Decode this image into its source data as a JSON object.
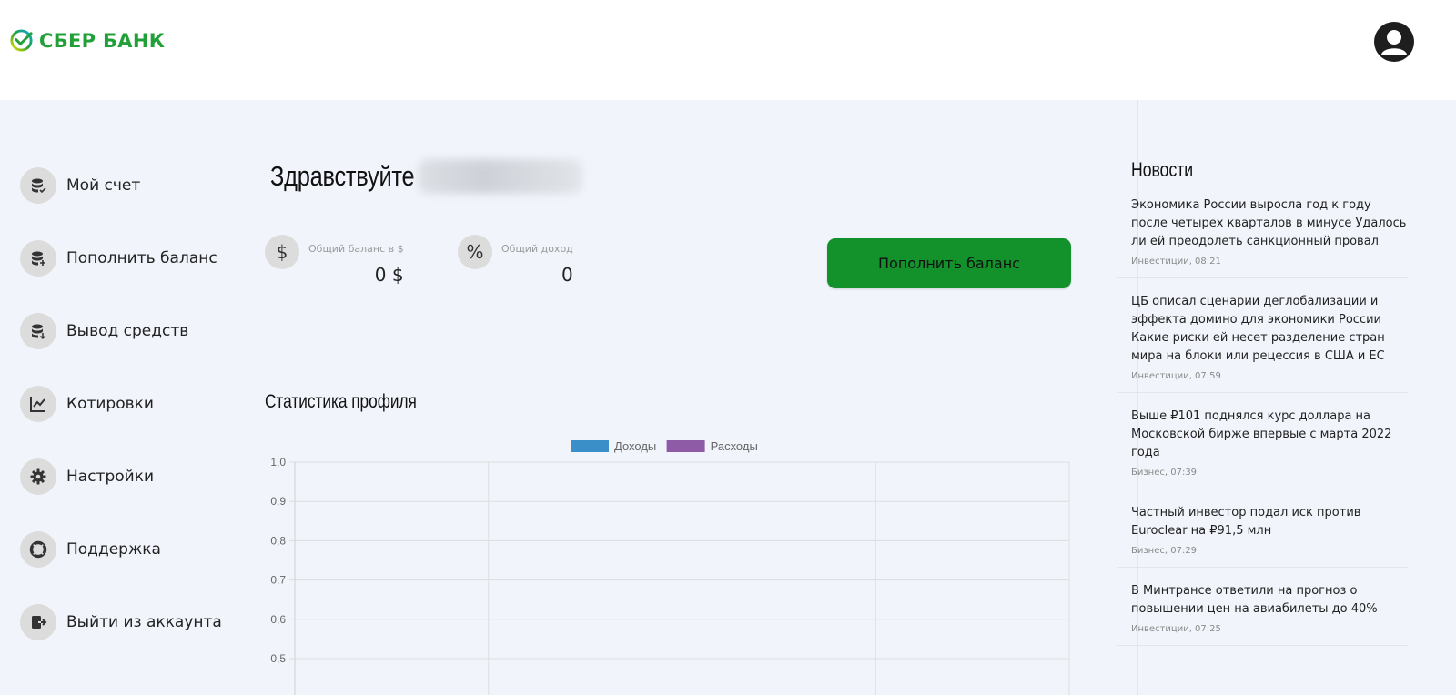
{
  "header": {
    "logo_text": "СБЕР БАНК",
    "logo_icon": "sber-check-icon",
    "avatar_icon": "user-avatar-icon",
    "brand_color": "#21a038"
  },
  "sidebar": {
    "items": [
      {
        "label": "Мой счет",
        "icon": "coins-check-icon"
      },
      {
        "label": "Пополнить баланс",
        "icon": "coins-plus-icon"
      },
      {
        "label": "Вывод средств",
        "icon": "coins-down-icon"
      },
      {
        "label": "Котировки",
        "icon": "chart-line-icon"
      },
      {
        "label": "Настройки",
        "icon": "gear-icon"
      },
      {
        "label": "Поддержка",
        "icon": "lifebuoy-icon"
      },
      {
        "label": "Выйти из аккаунта",
        "icon": "logout-icon"
      }
    ]
  },
  "greeting": {
    "text": "Здравствуйте"
  },
  "stats": {
    "balance": {
      "icon": "$",
      "label": "Общий баланс в $",
      "value": "0 $"
    },
    "income": {
      "icon": "%",
      "label": "Общий доход",
      "value": "0"
    }
  },
  "topup_button": {
    "label": "Пополнить баланс",
    "color": "#13922b"
  },
  "profile_stats": {
    "title": "Статистика профиля"
  },
  "chart_data": {
    "type": "bar",
    "series": [
      {
        "name": "Доходы",
        "color": "#3b8fc9",
        "values": []
      },
      {
        "name": "Расходы",
        "color": "#8e5ba6",
        "values": []
      }
    ],
    "y_ticks": [
      "1,0",
      "0,9",
      "0,8",
      "0,7",
      "0,6",
      "0,5"
    ],
    "ylim": [
      0,
      1
    ],
    "grid": true,
    "legend": "top-center"
  },
  "news": {
    "title": "Новости",
    "items": [
      {
        "headline": "Экономика России выросла год к году после четырех кварталов в минусе Удалось ли ей преодолеть санкционный провал",
        "meta": "Инвестиции, 08:21"
      },
      {
        "headline": "ЦБ описал сценарии деглобализации и эффекта домино для экономики России Какие риски ей несет разделение стран мира на блоки или рецессия в США и ЕС",
        "meta": "Инвестиции, 07:59"
      },
      {
        "headline": "Выше ₽101 поднялся курс доллара на Московской бирже впервые с марта 2022 года",
        "meta": "Бизнес, 07:39"
      },
      {
        "headline": "Частный инвестор подал иск против Euroclear на ₽91,5 млн",
        "meta": "Бизнес, 07:29"
      },
      {
        "headline": "В Минтрансе ответили на прогноз о повышении цен на авиабилеты до 40%",
        "meta": "Инвестиции, 07:25"
      }
    ]
  }
}
